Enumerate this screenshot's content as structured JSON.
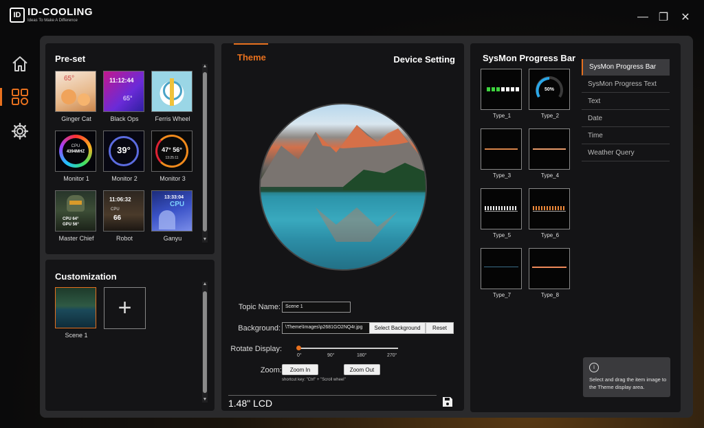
{
  "app": {
    "logo_mark": "ID",
    "name": "ID-COOLING",
    "tagline": "Ideas To Make A Difference"
  },
  "window_controls": {
    "minimize": "—",
    "restore": "❐",
    "close": "✕"
  },
  "sidebar": {
    "items": [
      {
        "icon": "home-icon"
      },
      {
        "icon": "grid-icon",
        "active": true
      },
      {
        "icon": "gear-icon"
      }
    ]
  },
  "preset": {
    "title": "Pre-set",
    "items": [
      {
        "label": "Ginger Cat",
        "thumb_text": "65°"
      },
      {
        "label": "Black Ops",
        "thumb_text": "11:12:44",
        "thumb_text2": "65°"
      },
      {
        "label": "Ferris Wheel"
      },
      {
        "label": "Monitor 1",
        "thumb_text": "CPU",
        "thumb_text2": "4394MHZ"
      },
      {
        "label": "Monitor 2",
        "thumb_text": "39°"
      },
      {
        "label": "Monitor 3",
        "thumb_text": "47°  56°",
        "thumb_text2": "13:25:11"
      },
      {
        "label": "Master Chief",
        "thumb_text": "CPU 64°",
        "thumb_text2": "GPU 56°"
      },
      {
        "label": "Robot",
        "thumb_text": "11:06:32",
        "thumb_text2": "CPU",
        "thumb_text3": "66"
      },
      {
        "label": "Ganyu",
        "thumb_text": "13:33:04",
        "thumb_text2": "CPU"
      }
    ]
  },
  "customization": {
    "title": "Customization",
    "items": [
      {
        "label": "Scene 1"
      }
    ],
    "add_label": "+"
  },
  "center": {
    "tab_theme": "Theme",
    "tab_device": "Device Setting",
    "topic_name_label": "Topic Name:",
    "topic_name_value": "Scene 1",
    "background_label": "Background:",
    "background_value": "\\Theme\\Images\\p2681GO2NQ4r.jpg",
    "select_background": "Select Background",
    "reset": "Reset",
    "rotate_label": "Rotate Display:",
    "rotate_ticks": [
      "0°",
      "90°",
      "180°",
      "270°"
    ],
    "rotate_value_deg": 0,
    "zoom_label": "Zoom:",
    "zoom_in": "Zoom In",
    "zoom_out": "Zoom Out",
    "shortcut": "shortcut key:  \"Ctrl\" + \"Scroll wheel\"",
    "lcd_label": "1.48\" LCD"
  },
  "sysmon": {
    "title": "SysMon Progress Bar",
    "types": [
      {
        "label": "Type_1"
      },
      {
        "label": "Type_2",
        "value_text": "50%"
      },
      {
        "label": "Type_3"
      },
      {
        "label": "Type_4"
      },
      {
        "label": "Type_5"
      },
      {
        "label": "Type_6"
      },
      {
        "label": "Type_7"
      },
      {
        "label": "Type_8"
      }
    ],
    "menu": [
      {
        "label": "SysMon Progress Bar",
        "active": true
      },
      {
        "label": "SysMon Progress Text"
      },
      {
        "label": "Text"
      },
      {
        "label": "Date"
      },
      {
        "label": "Time"
      },
      {
        "label": "Weather Query"
      }
    ],
    "info_icon": "i",
    "info_text": "Select and drag the item image to the Theme display area."
  },
  "colors": {
    "accent": "#e8711e",
    "panel": "#141416",
    "frame": "#2a2a2c"
  }
}
